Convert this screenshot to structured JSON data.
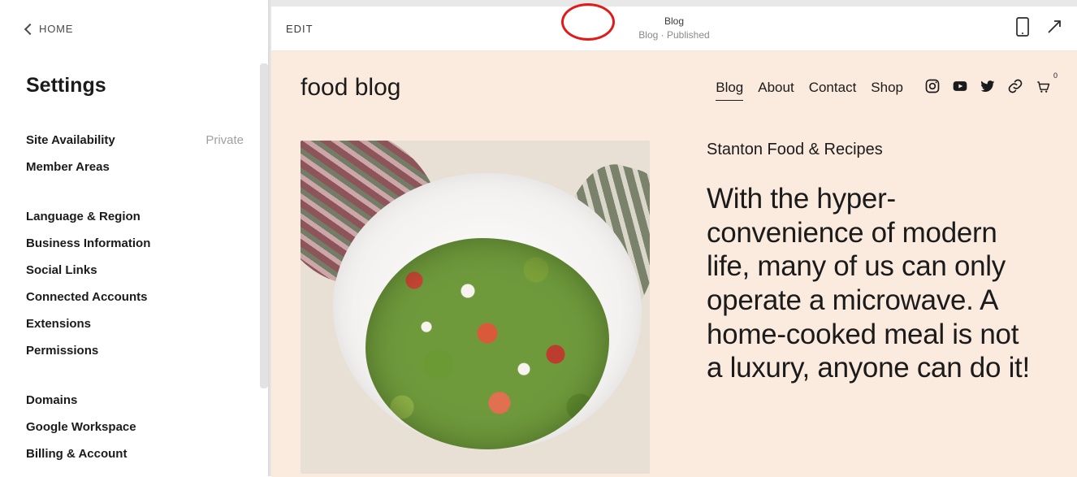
{
  "sidebar": {
    "home_label": "HOME",
    "title": "Settings",
    "group1": [
      {
        "label": "Site Availability",
        "value": "Private"
      },
      {
        "label": "Member Areas",
        "value": ""
      }
    ],
    "group2": [
      {
        "label": "Language & Region"
      },
      {
        "label": "Business Information"
      },
      {
        "label": "Social Links"
      },
      {
        "label": "Connected Accounts"
      },
      {
        "label": "Extensions"
      },
      {
        "label": "Permissions"
      }
    ],
    "group3": [
      {
        "label": "Domains"
      },
      {
        "label": "Google Workspace"
      },
      {
        "label": "Billing & Account"
      }
    ]
  },
  "preview": {
    "edit_label": "EDIT",
    "page_title": "Blog",
    "page_sub": "Blog · Published"
  },
  "site": {
    "brand": "food blog",
    "nav": [
      "Blog",
      "About",
      "Contact",
      "Shop"
    ],
    "active_nav": "Blog",
    "cart_count": "0",
    "article": {
      "kicker": "Stanton Food & Recipes",
      "headline": "With the hyper-convenience of modern life, many of us can only operate a microwave. A home-cooked meal is not a luxury, anyone can do it!"
    }
  }
}
